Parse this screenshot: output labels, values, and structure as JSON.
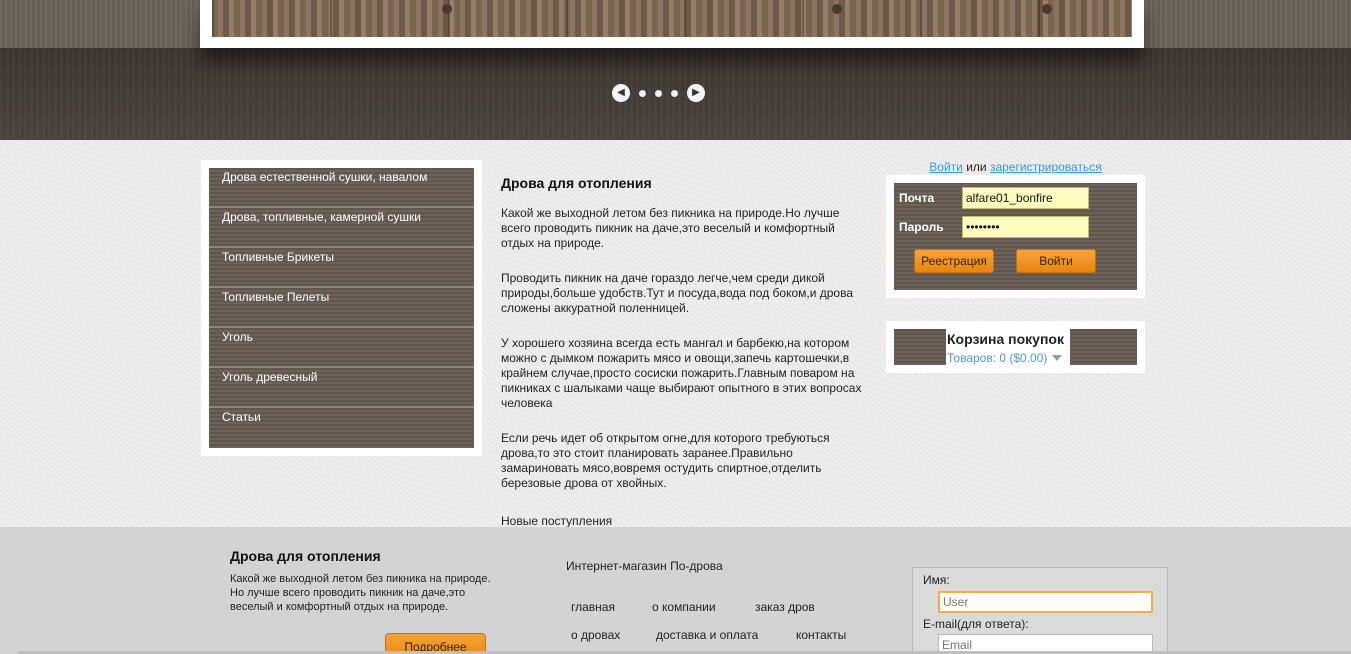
{
  "slider": {
    "prev_icon": "chevron-left",
    "next_icon": "chevron-right",
    "prev_glyph": "◀",
    "next_glyph": "▶",
    "dots": 3
  },
  "categories": [
    {
      "label": "Дрова естественной сушки, навалом"
    },
    {
      "label": "Дрова, топливные, камерной сушки"
    },
    {
      "label": "Топливные Брикеты"
    },
    {
      "label": "Топливные Пелеты"
    },
    {
      "label": "Уголь"
    },
    {
      "label": "Уголь древесный"
    },
    {
      "label": "Статьи"
    }
  ],
  "article": {
    "title": "Дрова для отопления",
    "paragraphs": [
      "Какой же выходной летом без пикника на природе.Но лучше всего проводить пикник на даче,это веселый и комфортный отдых на природе.",
      "Проводить пикник на даче гораздо легче,чем среди дикой природы,больше удобств.Тут и посуда,вода под боком,и дрова сложены аккуратной поленницей.",
      "У хорошего хозяина всегда есть мангал и барбекю,на котором можно с дымком пожарить мясо и овощи,запечь картошечки,в крайнем случае,просто сосиски пожарить.Главным поваром на пикниках с шалыками чаще выбирают опытного в этих вопросах человека",
      "Если речь идет об открытом огне,для которого требуються дрова,то это стоит планировать заранее.Правильно замариновать мясо,вовремя остудить спиртное,отделить березовые дрова от хвойных."
    ],
    "new_arrivals": "Новые поступления"
  },
  "auth": {
    "login_link": "Войти",
    "or": "или",
    "register_link": "зарегистрироваться"
  },
  "login": {
    "email_label": "Почта",
    "email_value": "alfare01_bonfire",
    "password_label": "Пароль",
    "password_value": "••••••••",
    "register_button": "Реестрация",
    "login_button": "Войти"
  },
  "cart": {
    "title": "Корзина покупок",
    "count": "Товаров: 0 ($0.00)"
  },
  "footer": {
    "title": "Дрова для отопления",
    "text": "Какой же выходной летом без пикника на природе. Но лучше всего проводить пикник на даче,это веселый и комфортный отдых на природе.",
    "more_button": "Подробнее",
    "shop_name": "Интернет-магазин По-дрова",
    "nav": {
      "home": "главная",
      "about": "о компании",
      "order": "заказ дров",
      "wood": "о дровах",
      "delivery": "доставка и оплата",
      "contacts": "контакты"
    },
    "feedback": {
      "name_label": "Имя:",
      "name_placeholder": "User",
      "email_label": "E-mail(для ответа):",
      "email_placeholder": "Email"
    }
  },
  "colors": {
    "accent_orange": "#f09a2a",
    "link_blue": "#3a9ad6",
    "wood_dark": "#655b52"
  }
}
